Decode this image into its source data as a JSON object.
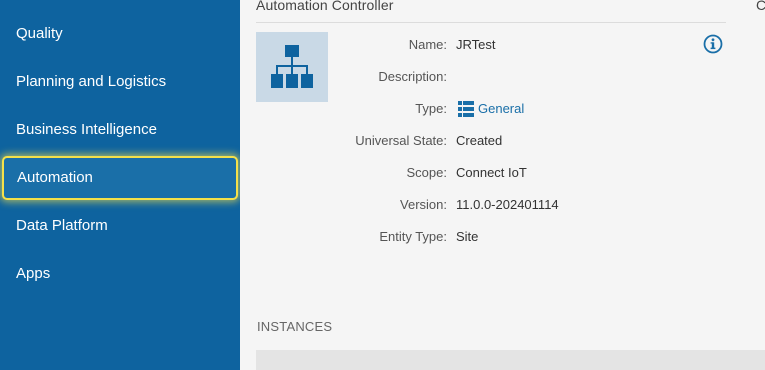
{
  "sidebar": {
    "items": [
      {
        "label": "Quality"
      },
      {
        "label": "Planning and Logistics"
      },
      {
        "label": "Business Intelligence"
      },
      {
        "label": "Automation",
        "active": true
      },
      {
        "label": "Data Platform"
      },
      {
        "label": "Apps"
      }
    ]
  },
  "section": {
    "title": "Automation Controller",
    "next_section_partial": "C"
  },
  "properties": {
    "name": {
      "label": "Name:",
      "value": "JRTest"
    },
    "description": {
      "label": "Description:",
      "value": ""
    },
    "type": {
      "label": "Type:",
      "value": "General",
      "icon": "list-icon"
    },
    "universal_state": {
      "label": "Universal State:",
      "value": "Created"
    },
    "scope": {
      "label": "Scope:",
      "value": "Connect IoT"
    },
    "version": {
      "label": "Version:",
      "value": "11.0.0-202401114"
    },
    "entity_type": {
      "label": "Entity Type:",
      "value": "Site"
    }
  },
  "instances": {
    "title": "INSTANCES"
  },
  "icons": {
    "entity": "hierarchy-icon",
    "info": "info-icon"
  },
  "colors": {
    "sidebar": "#0e639f",
    "highlight": "#f4e14a",
    "accent": "#1a6fa8"
  }
}
